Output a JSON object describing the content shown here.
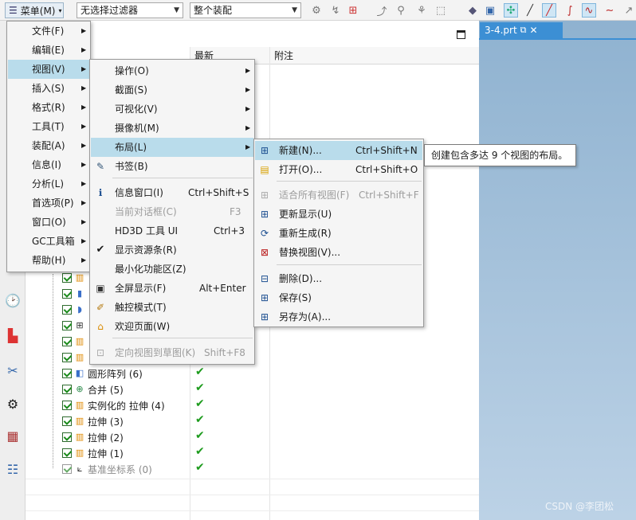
{
  "toolbar": {
    "menu_label": "菜单(M)",
    "filter_combo": "无选择过滤器",
    "scope_combo": "整个装配"
  },
  "nav": {
    "columns": [
      "最新",
      "附注"
    ],
    "rows": [
      {
        "label": "圆形阵列 (6)",
        "icon": "circular-pattern-icon",
        "check": true
      },
      {
        "label": "合并 (5)",
        "icon": "unite-icon",
        "check": true
      },
      {
        "label": "实例化的 拉伸 (4)",
        "icon": "extrude-icon",
        "check": true
      },
      {
        "label": "拉伸 (3)",
        "icon": "extrude-icon",
        "check": true
      },
      {
        "label": "拉伸 (2)",
        "icon": "extrude-icon",
        "check": true
      },
      {
        "label": "拉伸 (1)",
        "icon": "extrude-icon",
        "check": true
      },
      {
        "label": "基准坐标系 (0)",
        "icon": "datum-csys-icon",
        "check": true
      }
    ]
  },
  "viewport": {
    "tab_label": "3-4.prt"
  },
  "main_menu": [
    {
      "label": "文件(F)"
    },
    {
      "label": "编辑(E)"
    },
    {
      "label": "视图(V)"
    },
    {
      "label": "插入(S)"
    },
    {
      "label": "格式(R)"
    },
    {
      "label": "工具(T)"
    },
    {
      "label": "装配(A)"
    },
    {
      "label": "信息(I)"
    },
    {
      "label": "分析(L)"
    },
    {
      "label": "首选项(P)"
    },
    {
      "label": "窗口(O)"
    },
    {
      "label": "GC工具箱"
    },
    {
      "label": "帮助(H)"
    }
  ],
  "view_menu": [
    {
      "label": "操作(O)",
      "shortcut": ""
    },
    {
      "label": "截面(S)",
      "shortcut": ""
    },
    {
      "label": "可视化(V)",
      "shortcut": ""
    },
    {
      "label": "摄像机(M)",
      "shortcut": ""
    },
    {
      "label": "布局(L)",
      "shortcut": ""
    },
    {
      "label": "书签(B)",
      "shortcut": ""
    },
    {
      "label": "信息窗口(I)",
      "shortcut": "Ctrl+Shift+S"
    },
    {
      "label": "当前对话框(C)",
      "shortcut": "F3"
    },
    {
      "label": "HD3D 工具 UI",
      "shortcut": "Ctrl+3"
    },
    {
      "label": "显示资源条(R)",
      "shortcut": ""
    },
    {
      "label": "最小化功能区(Z)",
      "shortcut": ""
    },
    {
      "label": "全屏显示(F)",
      "shortcut": "Alt+Enter"
    },
    {
      "label": "触控模式(T)",
      "shortcut": ""
    },
    {
      "label": "欢迎页面(W)",
      "shortcut": ""
    },
    {
      "label": "定向视图到草图(K)",
      "shortcut": "Shift+F8"
    }
  ],
  "layout_menu": [
    {
      "label": "新建(N)...",
      "shortcut": "Ctrl+Shift+N"
    },
    {
      "label": "打开(O)...",
      "shortcut": "Ctrl+Shift+O"
    },
    {
      "label": "适合所有视图(F)",
      "shortcut": "Ctrl+Shift+F"
    },
    {
      "label": "更新显示(U)",
      "shortcut": ""
    },
    {
      "label": "重新生成(R)",
      "shortcut": ""
    },
    {
      "label": "替换视图(V)...",
      "shortcut": ""
    },
    {
      "label": "删除(D)...",
      "shortcut": ""
    },
    {
      "label": "保存(S)",
      "shortcut": ""
    },
    {
      "label": "另存为(A)...",
      "shortcut": ""
    }
  ],
  "tooltip": "创建包含多达 9 个视图的布局。",
  "watermark": "CSDN @李团松"
}
